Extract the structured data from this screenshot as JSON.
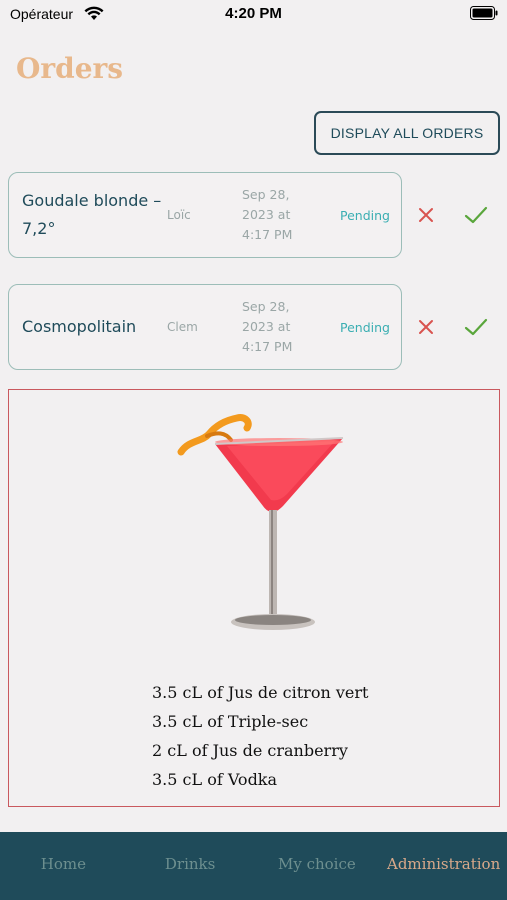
{
  "status_bar": {
    "carrier": "Opérateur",
    "time": "4:20 PM"
  },
  "page": {
    "title": "Orders"
  },
  "actions": {
    "display_all_label": "DISPLAY ALL ORDERS"
  },
  "orders": [
    {
      "name": "Goudale blonde – 7,2°",
      "user": "Loïc",
      "date": "Sep 28, 2023 at 4:17 PM",
      "status": "Pending"
    },
    {
      "name": "Cosmopolitain",
      "user": "Clem",
      "date": "Sep 28, 2023 at 4:17 PM",
      "status": "Pending"
    }
  ],
  "selected_drink": {
    "ingredients": [
      "3.5 cL of Jus de citron vert",
      "3.5 cL of Triple-sec",
      "2 cL of Jus de cranberry",
      "3.5 cL of Vodka"
    ]
  },
  "tabs": [
    {
      "label": "Home"
    },
    {
      "label": "Drinks"
    },
    {
      "label": "My choice"
    },
    {
      "label": "Administration",
      "active": true
    }
  ],
  "colors": {
    "accent": "#e8b88c",
    "primary": "#1f4b5a",
    "pending": "#3aaeb2",
    "reject": "#d9534f",
    "accept": "#5aa63c",
    "panel_border": "#c9585e"
  }
}
